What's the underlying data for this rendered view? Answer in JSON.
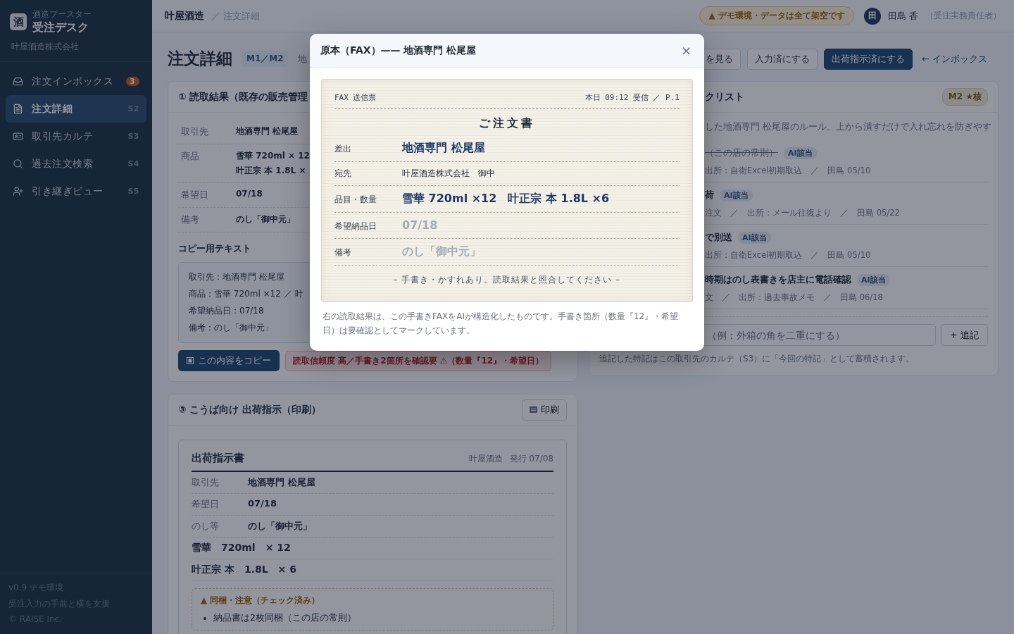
{
  "sidebar": {
    "logo": "酒",
    "app_subtitle": "酒造ブースター",
    "app_title": "受注デスク",
    "company": "叶屋酒造株式会社",
    "items": [
      {
        "label": "注文インボックス",
        "badge": "3",
        "selected": false
      },
      {
        "label": "注文詳細",
        "shortcut": "S2",
        "selected": true
      },
      {
        "label": "取引先カルテ",
        "shortcut": "S3",
        "selected": false
      },
      {
        "label": "過去注文検索",
        "shortcut": "S4",
        "selected": false
      },
      {
        "label": "引き継ぎビュー",
        "shortcut": "S5",
        "selected": false
      }
    ],
    "footer": [
      "v0.9 デモ環境",
      "受注入力の手前と横を支援",
      "© RAISE Inc."
    ]
  },
  "topbar": {
    "root": "叶屋酒造",
    "current": "／ 注文詳細",
    "demo_notice": "▲ デモ環境・データは全て架空です",
    "user": {
      "initial": "田",
      "name": "田島 香",
      "role": "（受注実務責任者）"
    }
  },
  "page": {
    "title": "注文詳細",
    "tag": "M1／M2",
    "subtitle": "地",
    "actions": [
      {
        "label": "を見る",
        "kind": "outline"
      },
      {
        "label": "入力済にする",
        "kind": "outline"
      },
      {
        "label": "出荷指示済にする",
        "kind": "primary"
      },
      {
        "label": "← インボックス",
        "kind": "link"
      }
    ]
  },
  "reading_card": {
    "title": "① 読取結果（既存の販売管理",
    "rows": [
      {
        "label": "取引先",
        "values": [
          "地酒専門 松尾屋"
        ]
      },
      {
        "label": "商品",
        "values": [
          "雪華 720ml × 12",
          "叶正宗 本 1.8L ×"
        ]
      },
      {
        "label": "希望日",
        "values": [
          "07/18"
        ]
      },
      {
        "label": "備考",
        "values": [
          "のし「**御中元**」"
        ]
      }
    ],
    "copy_heading": "コピー用テキスト",
    "copy_lines": [
      "取引先：地酒専門 松尾屋",
      "商品：雪華 720ml ×12 ／ 叶",
      "希望納品日：07/18",
      "備考：のし「御中元」"
    ],
    "copy_button": "この内容をコピー",
    "confidence": "読取信頼度 高／手書き2箇所を確認要 ⚠（数量『12』・希望日）"
  },
  "shipping_card": {
    "title": "③ こうば向け 出荷指示（印刷）",
    "print_button": "印刷",
    "doc_title": "出荷指示書",
    "issuer": "叶屋酒造",
    "issued": "発行 07/08",
    "rows": [
      {
        "label": "取引先",
        "value": "地酒専門 松尾屋"
      },
      {
        "label": "希望日",
        "value": "07/18"
      },
      {
        "label": "のし等",
        "value": "のし「御中元」"
      }
    ],
    "items": [
      {
        "name": "雪華",
        "size": "720ml",
        "qty": "× 12"
      },
      {
        "name": "叶正宗 本",
        "size": "1.8L",
        "qty": "× 6"
      }
    ],
    "notice_title": "▲ 同梱・注意（チェック済み）",
    "notices": [
      "納品書は2枚同梱（この店の常則）"
    ]
  },
  "checklist_card": {
    "title": "クリスト",
    "badge": "M2 ★核",
    "description": "した地酒専門 松尾屋のルール。上から潰すだけで入れ忘れを防ぎやす",
    "items": [
      {
        "title": "（この店の常則）",
        "done": true,
        "tag": "AI該当",
        "meta": "出所：自衛Excel初期取込　／　田島 05/10"
      },
      {
        "title": "荷",
        "done": false,
        "tag": "AI該当",
        "meta": "注文　／　出所：メール往復より　／　田島 05/22"
      },
      {
        "title": "で別送",
        "done": false,
        "tag": "AI該当",
        "meta": "出所：自衛Excel初期取込　／　田島 05/10"
      },
      {
        "title": "時期はのし表書きを店主に電話確認",
        "done": false,
        "tag": "AI該当",
        "meta": "文　／　出所：過去事故メモ　／　田島 06/18"
      }
    ],
    "placeholder": "（例：外箱の角を二重にする）",
    "add_button": "+ 追記",
    "note": "追記した特記はこの取引先のカルテ（S3）に「今回の特記」として蓄積されます。"
  },
  "modal": {
    "title": "原本（FAX）—— 地酒専門 松尾屋",
    "close": "×",
    "fax_label": "FAX 送信票",
    "received": "本日 09:12 受信 ／ P.1",
    "doc_title": "ご注文書",
    "rows": [
      {
        "label": "差出",
        "value": "地酒専門 松尾屋",
        "kind": "hand"
      },
      {
        "label": "宛先",
        "value": "叶屋酒造株式会社　御中",
        "kind": "print"
      },
      {
        "label": "品目・数量",
        "value": "雪華 720ml ×12　叶正宗 本 1.8L ×6",
        "kind": "hand"
      },
      {
        "label": "希望納品日",
        "value": "07/18",
        "kind": "faint"
      },
      {
        "label": "備考",
        "value": "のし「御中元」",
        "kind": "faint"
      }
    ],
    "footer": "– 手書き・かすれあり。読取結果と照合してください –",
    "caption": "右の読取結果は、この手書きFAXをAIが構造化したものです。手書き箇所（数量『12』・希望日）は要確認としてマークしています。"
  }
}
